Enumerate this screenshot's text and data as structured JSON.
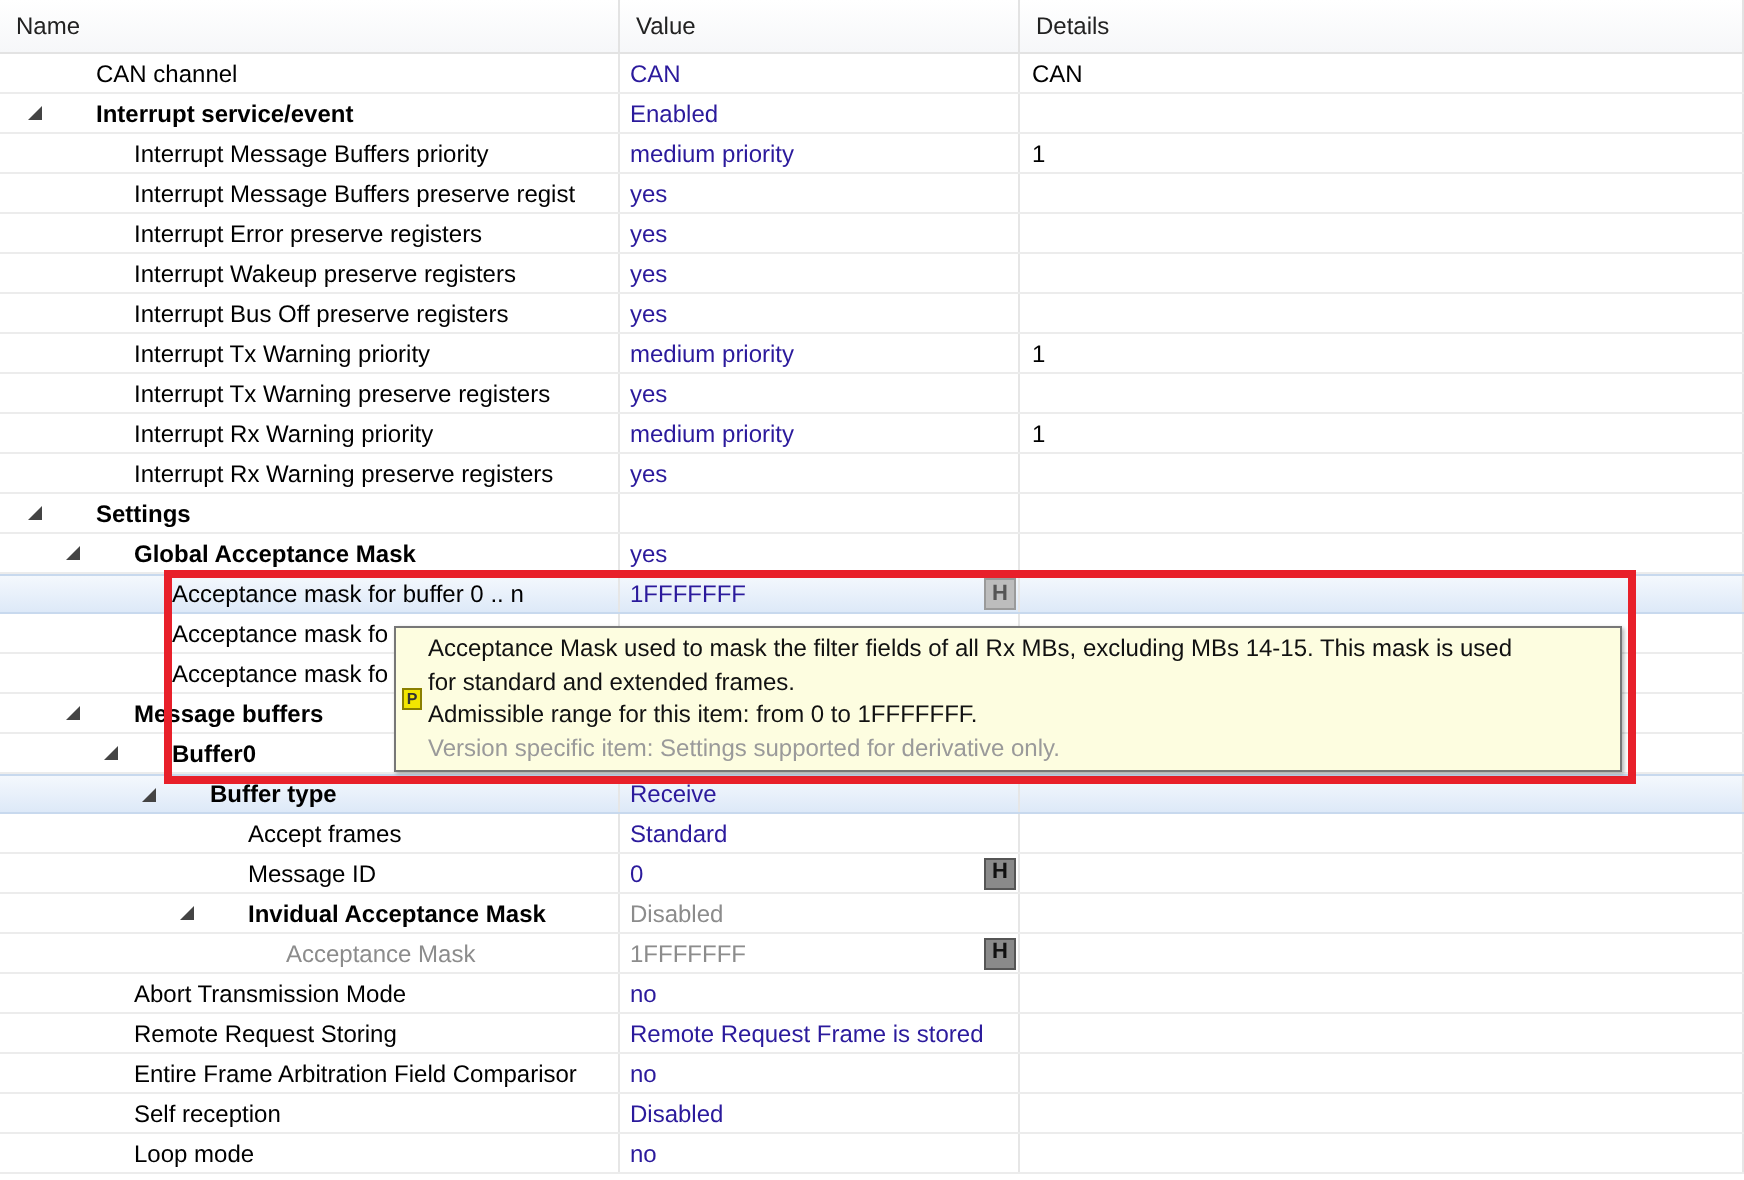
{
  "columns": [
    "Name",
    "Value",
    "Details"
  ],
  "rows": [
    {
      "name": "CAN channel",
      "value": "CAN",
      "details": "CAN",
      "bold": false,
      "disabled": false,
      "selected": false
    },
    {
      "name": "Interrupt service/event",
      "value": "Enabled",
      "bold": true,
      "disabled": false,
      "selected": false,
      "expanded": true,
      "children": [
        {
          "name": "Interrupt Message Buffers priority",
          "value": "medium priority",
          "details": "1",
          "bold": false,
          "disabled": false,
          "selected": false
        },
        {
          "name": "Interrupt Message Buffers preserve regist",
          "value": "yes",
          "bold": false,
          "disabled": false,
          "selected": false
        },
        {
          "name": "Interrupt Error preserve registers",
          "value": "yes",
          "bold": false,
          "disabled": false,
          "selected": false
        },
        {
          "name": "Interrupt Wakeup preserve registers",
          "value": "yes",
          "bold": false,
          "disabled": false,
          "selected": false
        },
        {
          "name": "Interrupt Bus Off preserve registers",
          "value": "yes",
          "bold": false,
          "disabled": false,
          "selected": false
        },
        {
          "name": "Interrupt Tx Warning priority",
          "value": "medium priority",
          "details": "1",
          "bold": false,
          "disabled": false,
          "selected": false
        },
        {
          "name": "Interrupt Tx Warning preserve registers",
          "value": "yes",
          "bold": false,
          "disabled": false,
          "selected": false
        },
        {
          "name": "Interrupt Rx Warning priority",
          "value": "medium priority",
          "details": "1",
          "bold": false,
          "disabled": false,
          "selected": false
        },
        {
          "name": "Interrupt Rx Warning preserve registers",
          "value": "yes",
          "bold": false,
          "disabled": false,
          "selected": false
        }
      ]
    },
    {
      "name": "Settings",
      "bold": true,
      "selected": false,
      "expanded": true,
      "children": [
        {
          "name": "Global Acceptance Mask",
          "value": "yes",
          "bold": true,
          "disabled": false,
          "selected": false,
          "expanded": true,
          "children": [
            {
              "name": "Acceptance mask for buffer 0 .. n",
              "value": "1FFFFFFF",
              "badge": "H",
              "bold": false,
              "disabled": false,
              "selected": true
            },
            {
              "name": "Acceptance mask fo",
              "bold": false,
              "disabled": false,
              "selected": false
            },
            {
              "name": "Acceptance mask fo",
              "bold": false,
              "disabled": false,
              "selected": false
            }
          ]
        },
        {
          "name": "Message buffers",
          "bold": true,
          "selected": false,
          "expanded": true,
          "children": [
            {
              "name": "Buffer0",
              "bold": true,
              "selected": false,
              "expanded": true,
              "children": [
                {
                  "name": "Buffer type",
                  "value": "Receive",
                  "bold": true,
                  "disabled": false,
                  "selected": true,
                  "expanded": true,
                  "children": [
                    {
                      "name": "Accept frames",
                      "value": "Standard",
                      "bold": false,
                      "disabled": false,
                      "selected": false
                    },
                    {
                      "name": "Message ID",
                      "value": "0",
                      "badge": "H",
                      "bold": false,
                      "disabled": false,
                      "selected": false
                    },
                    {
                      "name": "Invidual Acceptance Mask",
                      "value": "Disabled",
                      "bold": true,
                      "disabled": true,
                      "selected": false,
                      "expanded": true,
                      "children": [
                        {
                          "name": "Acceptance Mask",
                          "value": "1FFFFFFF",
                          "badge": "H",
                          "bold": false,
                          "disabled": true,
                          "selected": false
                        }
                      ]
                    }
                  ]
                }
              ]
            }
          ]
        },
        {
          "name": "Abort Transmission Mode",
          "value": "no",
          "bold": false,
          "disabled": false,
          "selected": false
        },
        {
          "name": "Remote Request Storing",
          "value": "Remote Request Frame is stored",
          "bold": false,
          "disabled": false,
          "selected": false
        },
        {
          "name": "Entire Frame Arbitration Field Comparisor",
          "value": "no",
          "bold": false,
          "disabled": false,
          "selected": false
        },
        {
          "name": "Self reception",
          "value": "Disabled",
          "bold": false,
          "disabled": false,
          "selected": false
        },
        {
          "name": "Loop mode",
          "value": "no",
          "bold": false,
          "disabled": false,
          "selected": false
        }
      ]
    }
  ],
  "tooltip": {
    "icon": "P",
    "lines": [
      "Acceptance Mask used to mask the filter fields of all Rx MBs, excluding MBs 14-15. This mask is used",
      "for standard and extended frames.",
      "Admissible range for this item: from 0 to 1FFFFFFF."
    ],
    "note": "Version specific item: Settings supported for derivative only."
  }
}
